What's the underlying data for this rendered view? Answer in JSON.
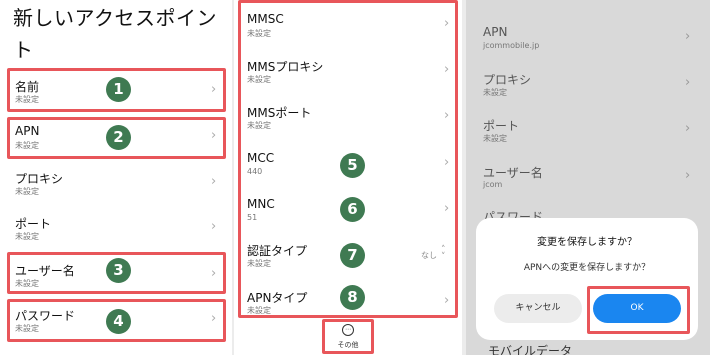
{
  "panel1": {
    "title_line1": "新しいアクセスポイン",
    "title_line2": "ト",
    "items": [
      {
        "label": "名前",
        "value": "未設定",
        "marker": "1"
      },
      {
        "label": "APN",
        "value": "未設定",
        "marker": "2"
      },
      {
        "label": "プロキシ",
        "value": "未設定"
      },
      {
        "label": "ポート",
        "value": "未設定"
      },
      {
        "label": "ユーザー名",
        "value": "未設定",
        "marker": "3"
      },
      {
        "label": "パスワード",
        "value": "未設定",
        "marker": "4"
      }
    ]
  },
  "panel2": {
    "items": [
      {
        "label": "MMSC",
        "value": "未設定"
      },
      {
        "label": "MMSプロキシ",
        "value": "未設定"
      },
      {
        "label": "MMSポート",
        "value": "未設定"
      },
      {
        "label": "MCC",
        "value": "440",
        "marker": "5"
      },
      {
        "label": "MNC",
        "value": "51",
        "marker": "6"
      },
      {
        "label": "認証タイプ",
        "value": "未設定",
        "option": "なし",
        "marker": "7"
      },
      {
        "label": "APNタイプ",
        "value": "未設定",
        "marker": "8"
      }
    ],
    "more_label": "その他"
  },
  "panel3": {
    "items": [
      {
        "label": "APN",
        "value": "jcommobile.jp"
      },
      {
        "label": "プロキシ",
        "value": "未設定"
      },
      {
        "label": "ポート",
        "value": "未設定"
      },
      {
        "label": "ユーザー名",
        "value": "jcom"
      },
      {
        "label": "パスワード",
        "value": ""
      }
    ],
    "bottom_item": "モバイルデータ",
    "dialog": {
      "title": "変更を保存しますか？",
      "message": "APNへの変更を保存しますか？",
      "cancel": "キャンセル",
      "ok": "OK"
    }
  },
  "colors": {
    "highlight": "#e8565a",
    "marker": "#3f7a52",
    "ok_button": "#1a86f0",
    "dim_overlay": "#d9d9d9"
  },
  "icons": {
    "row_chevron": "chevron-right-icon",
    "more": "more-horizontal-icon",
    "dropdown": "unfold-arrows-icon"
  }
}
